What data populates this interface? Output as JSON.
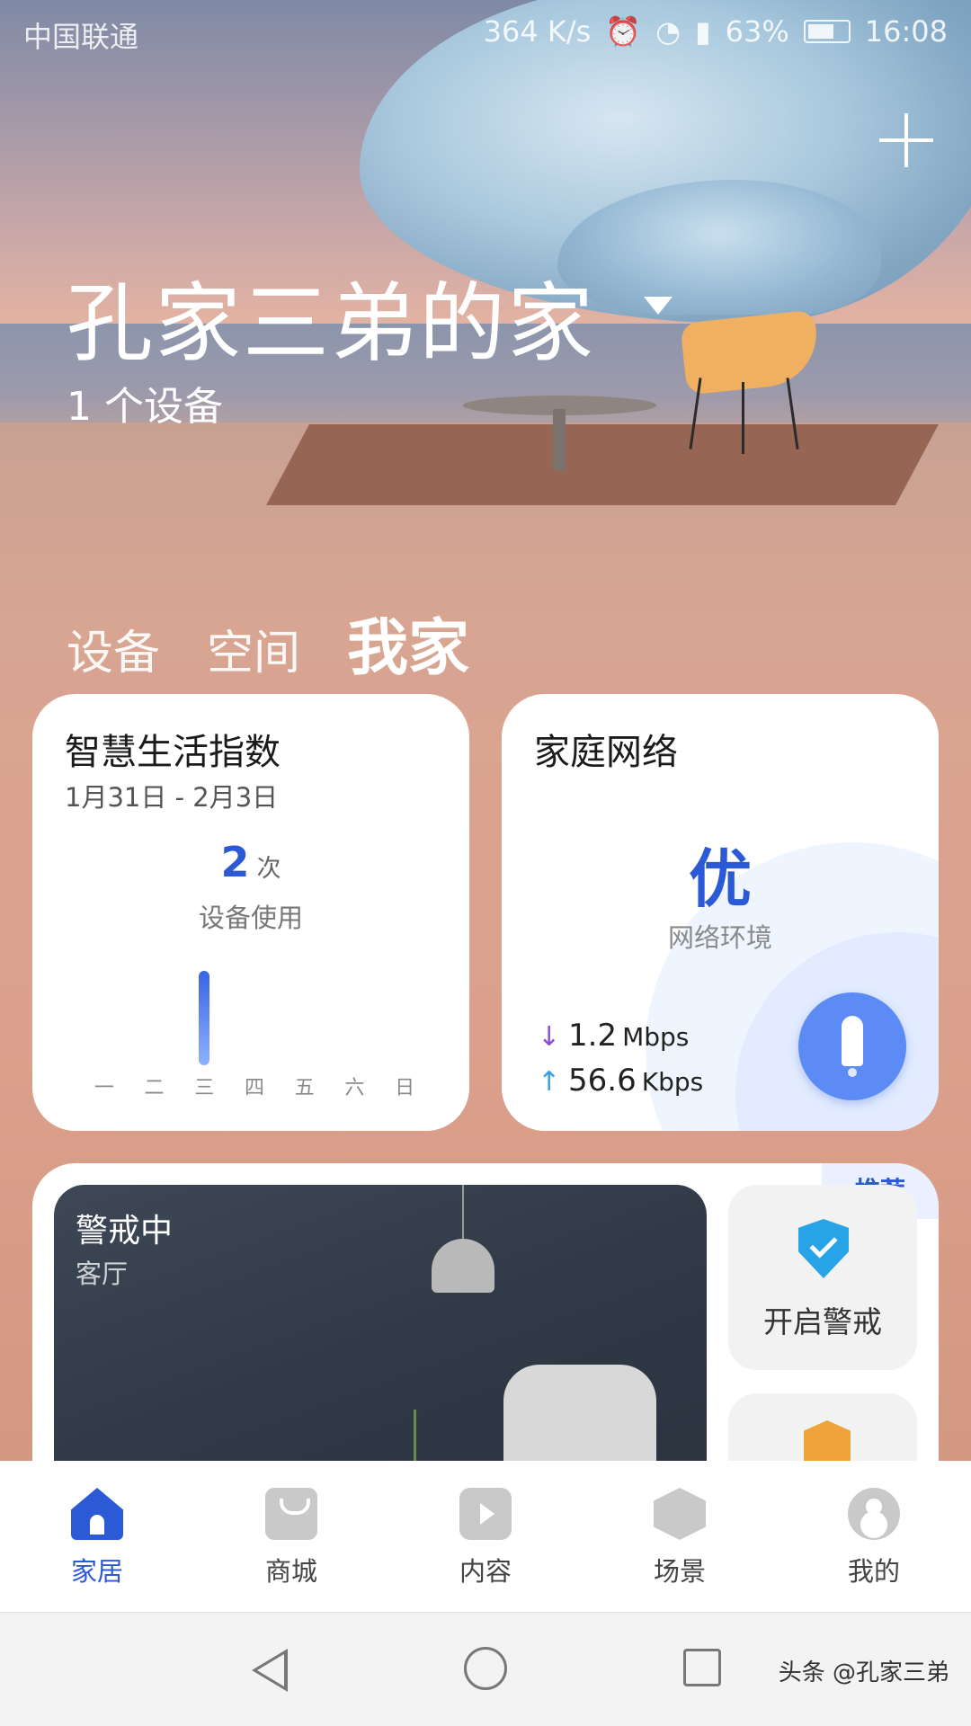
{
  "status_bar": {
    "carrier": "中国联通",
    "net_speed": "364 K/s",
    "battery": "63%",
    "time": "16:08"
  },
  "header": {
    "home_name": "孔家三弟的家",
    "device_count": "1 个设备"
  },
  "tabs": [
    {
      "label": "设备",
      "active": false
    },
    {
      "label": "空间",
      "active": false
    },
    {
      "label": "我家",
      "active": true
    }
  ],
  "smart_card": {
    "title": "智慧生活指数",
    "date_range": "1月31日 - 2月3日",
    "count": "2",
    "count_unit": "次",
    "count_label": "设备使用",
    "days": [
      "一",
      "二",
      "三",
      "四",
      "五",
      "六",
      "日"
    ],
    "usage_per_day": [
      0,
      0,
      2,
      0,
      0,
      0,
      0
    ],
    "bar_color": "#3a64e2"
  },
  "network_card": {
    "title": "家庭网络",
    "quality": "优",
    "quality_label": "网络环境",
    "download_value": "1.2",
    "download_unit": "Mbps",
    "upload_value": "56.6",
    "upload_unit": "Kbps",
    "accent": "#2c5ad6"
  },
  "security_card": {
    "title": "警戒中",
    "room": "客厅",
    "badge": "推荐",
    "action_label": "开启警戒"
  },
  "bottom_nav": [
    {
      "label": "家居",
      "icon": "home-icon",
      "active": true
    },
    {
      "label": "商城",
      "icon": "shop-icon",
      "active": false
    },
    {
      "label": "内容",
      "icon": "content-icon",
      "active": false
    },
    {
      "label": "场景",
      "icon": "scene-icon",
      "active": false
    },
    {
      "label": "我的",
      "icon": "profile-icon",
      "active": false
    }
  ],
  "watermark": "头条 @孔家三弟"
}
